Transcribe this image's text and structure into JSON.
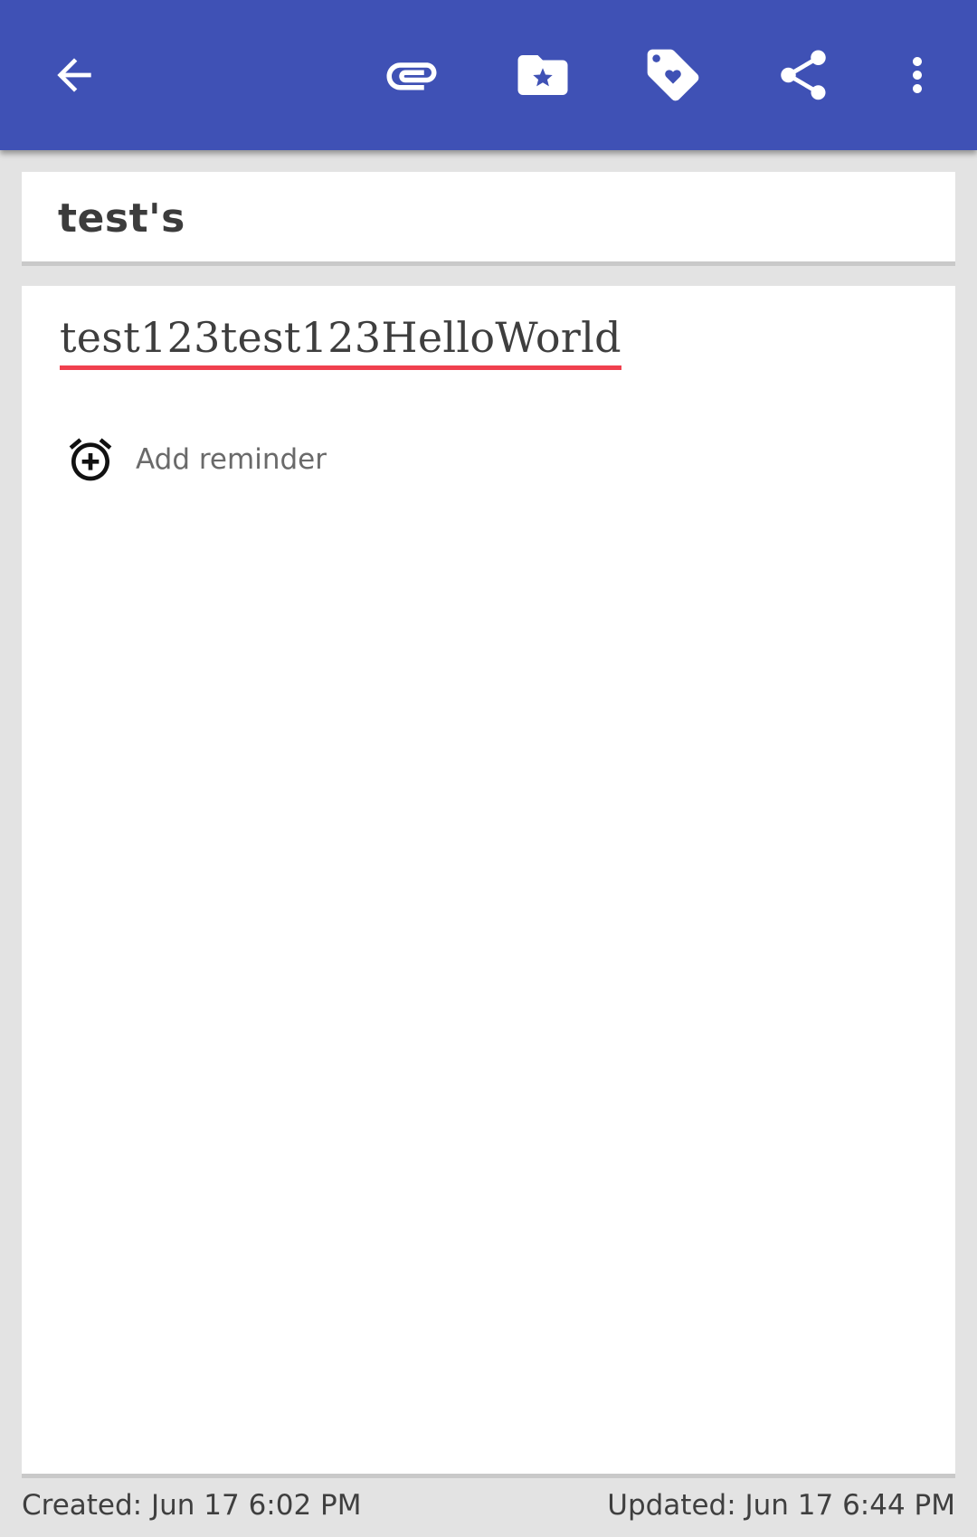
{
  "toolbar": {
    "color": "#3f51b5",
    "icons": {
      "back": "arrow-back-icon",
      "attach": "paperclip-icon",
      "category": "folder-star-icon",
      "tag": "tag-heart-icon",
      "share": "share-icon",
      "more": "more-vert-icon"
    }
  },
  "note": {
    "title": "test's",
    "content": "test123test123HelloWorld",
    "spellcheck_underline_color": "#f0404e"
  },
  "reminder": {
    "label": "Add reminder",
    "icon": "alarm-add-icon"
  },
  "footer": {
    "created": "Created: Jun 17 6:02 PM",
    "updated": "Updated: Jun 17 6:44 PM"
  }
}
